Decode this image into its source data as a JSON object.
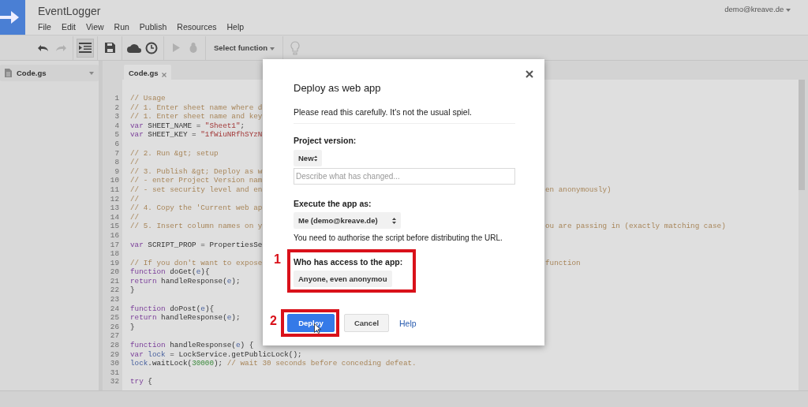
{
  "app": {
    "title": "EventLogger",
    "account": "demo@kreave.de"
  },
  "menu": [
    "File",
    "Edit",
    "View",
    "Run",
    "Publish",
    "Resources",
    "Help"
  ],
  "toolbar": [
    {
      "kind": "undo",
      "disabled": false,
      "pressed": false
    },
    {
      "kind": "redo",
      "disabled": true,
      "pressed": false
    },
    {
      "kind": "indent",
      "disabled": false,
      "pressed": true
    },
    {
      "kind": "save",
      "disabled": false,
      "pressed": false
    },
    {
      "kind": "publish",
      "disabled": false,
      "pressed": false
    },
    {
      "kind": "triggers",
      "disabled": false,
      "pressed": false
    },
    {
      "kind": "run",
      "disabled": true,
      "pressed": false
    },
    {
      "kind": "debug",
      "disabled": true,
      "pressed": false
    },
    {
      "kind": "function_select",
      "label": "Select function",
      "disabled": false
    },
    {
      "kind": "hint",
      "disabled": true,
      "pressed": false
    }
  ],
  "sidebar": {
    "files": [
      {
        "name": "Code.gs",
        "selected": true
      }
    ]
  },
  "editor": {
    "tabs": [
      {
        "label": "Code.gs",
        "selected": true
      }
    ],
    "lines": [
      {
        "number": "1",
        "left": [
          {
            "kind": "comment",
            "text": "// Usage"
          }
        ]
      },
      {
        "number": "2",
        "left": [
          {
            "kind": "comment",
            "text": "// 1. Enter sheet name where d"
          }
        ]
      },
      {
        "number": "3",
        "left": [
          {
            "kind": "comment",
            "text": "// 1. Enter sheet name and key"
          }
        ]
      },
      {
        "number": "4",
        "left": [
          {
            "kind": "keyword",
            "text": "var"
          },
          {
            "kind": "plain",
            "text": " SHEET_NAME = "
          },
          {
            "kind": "string",
            "text": "\"Sheet1\""
          },
          {
            "kind": "plain",
            "text": ";"
          }
        ]
      },
      {
        "number": "5",
        "left": [
          {
            "kind": "keyword",
            "text": "var"
          },
          {
            "kind": "plain",
            "text": " SHEET_KEY = "
          },
          {
            "kind": "string",
            "text": "\"1fWiuNRfhSYzN"
          }
        ]
      },
      {
        "number": "6"
      },
      {
        "number": "7",
        "left": [
          {
            "kind": "comment",
            "text": "// 2. Run &gt; setup"
          }
        ]
      },
      {
        "number": "8",
        "left": [
          {
            "kind": "comment",
            "text": "//"
          }
        ]
      },
      {
        "number": "9",
        "left": [
          {
            "kind": "comment",
            "text": "// 3. Publish &gt; Deploy as w"
          }
        ]
      },
      {
        "number": "10",
        "left": [
          {
            "kind": "comment",
            "text": "// - enter Project Version nam"
          }
        ]
      },
      {
        "number": "11",
        "left": [
          {
            "kind": "comment",
            "text": "// - set security level and en"
          }
        ],
        "right": [
          {
            "kind": "comment",
            "text": "en anonymously)"
          }
        ]
      },
      {
        "number": "12",
        "left": [
          {
            "kind": "comment",
            "text": "//"
          }
        ]
      },
      {
        "number": "13",
        "left": [
          {
            "kind": "comment",
            "text": "// 4. Copy the 'Current web ap"
          }
        ]
      },
      {
        "number": "14",
        "left": [
          {
            "kind": "comment",
            "text": "//"
          }
        ]
      },
      {
        "number": "15",
        "left": [
          {
            "kind": "comment",
            "text": "// 5. Insert column names on y"
          }
        ],
        "right": [
          {
            "kind": "comment",
            "text": "ou are passing in (exactly matching case)"
          }
        ]
      },
      {
        "number": "16"
      },
      {
        "number": "17",
        "left": [
          {
            "kind": "keyword",
            "text": "var"
          },
          {
            "kind": "plain",
            "text": " SCRIPT_PROP = PropertiesSe"
          }
        ]
      },
      {
        "number": "18"
      },
      {
        "number": "19",
        "left": [
          {
            "kind": "comment",
            "text": "// If you don't want to expose"
          }
        ],
        "right": [
          {
            "kind": "comment",
            "text": "function"
          }
        ]
      },
      {
        "number": "20",
        "left": [
          {
            "kind": "keyword",
            "text": "function"
          },
          {
            "kind": "plain",
            "text": " doGet("
          },
          {
            "kind": "variable",
            "text": "e"
          },
          {
            "kind": "plain",
            "text": "){"
          }
        ]
      },
      {
        "number": "21",
        "left": [
          {
            "kind": "keyword",
            "text": "return"
          },
          {
            "kind": "plain",
            "text": " handleResponse("
          },
          {
            "kind": "variable",
            "text": "e"
          },
          {
            "kind": "plain",
            "text": ");"
          }
        ]
      },
      {
        "number": "22",
        "left": [
          {
            "kind": "plain",
            "text": "}"
          }
        ]
      },
      {
        "number": "23"
      },
      {
        "number": "24",
        "left": [
          {
            "kind": "keyword",
            "text": "function"
          },
          {
            "kind": "plain",
            "text": " doPost("
          },
          {
            "kind": "variable",
            "text": "e"
          },
          {
            "kind": "plain",
            "text": "){"
          }
        ]
      },
      {
        "number": "25",
        "left": [
          {
            "kind": "keyword",
            "text": "return"
          },
          {
            "kind": "plain",
            "text": " handleResponse("
          },
          {
            "kind": "variable",
            "text": "e"
          },
          {
            "kind": "plain",
            "text": ");"
          }
        ]
      },
      {
        "number": "26",
        "left": [
          {
            "kind": "plain",
            "text": "}"
          }
        ]
      },
      {
        "number": "27"
      },
      {
        "number": "28",
        "left": [
          {
            "kind": "keyword",
            "text": "function"
          },
          {
            "kind": "plain",
            "text": " handleResponse("
          },
          {
            "kind": "variable",
            "text": "e"
          },
          {
            "kind": "plain",
            "text": ") {"
          }
        ]
      },
      {
        "number": "29",
        "left": [
          {
            "kind": "keyword",
            "text": "var"
          },
          {
            "kind": "variable",
            "text": " lock"
          },
          {
            "kind": "plain",
            "text": " = LockService.getPublicLock();"
          }
        ]
      },
      {
        "number": "30",
        "left": [
          {
            "kind": "variable",
            "text": "lock"
          },
          {
            "kind": "plain",
            "text": ".waitLock("
          },
          {
            "kind": "number",
            "text": "30000"
          },
          {
            "kind": "plain",
            "text": "); "
          },
          {
            "kind": "comment",
            "text": "// wait 30 seconds before conceding defeat."
          }
        ]
      },
      {
        "number": "31"
      },
      {
        "number": "32",
        "left": [
          {
            "kind": "keyword",
            "text": "try"
          },
          {
            "kind": "plain",
            "text": " {"
          }
        ]
      }
    ]
  },
  "dialog": {
    "title": "Deploy as web app",
    "intro": "Please read this carefully. It's not the usual spiel.",
    "version": {
      "label": "Project version:",
      "value": "New",
      "placeholder": "Describe what has changed..."
    },
    "execute": {
      "label": "Execute the app as:",
      "value": "Me (demo@kreave.de)",
      "note": "You need to authorise the script before distributing the URL."
    },
    "access": {
      "label": "Who has access to the app:",
      "value": "Anyone, even anonymou",
      "callout": "1"
    },
    "buttons": [
      {
        "kind": "primary",
        "label": "Deploy",
        "callout": "2",
        "hovered": true
      },
      {
        "kind": "secondary",
        "label": "Cancel"
      },
      {
        "kind": "link",
        "label": "Help"
      }
    ]
  }
}
